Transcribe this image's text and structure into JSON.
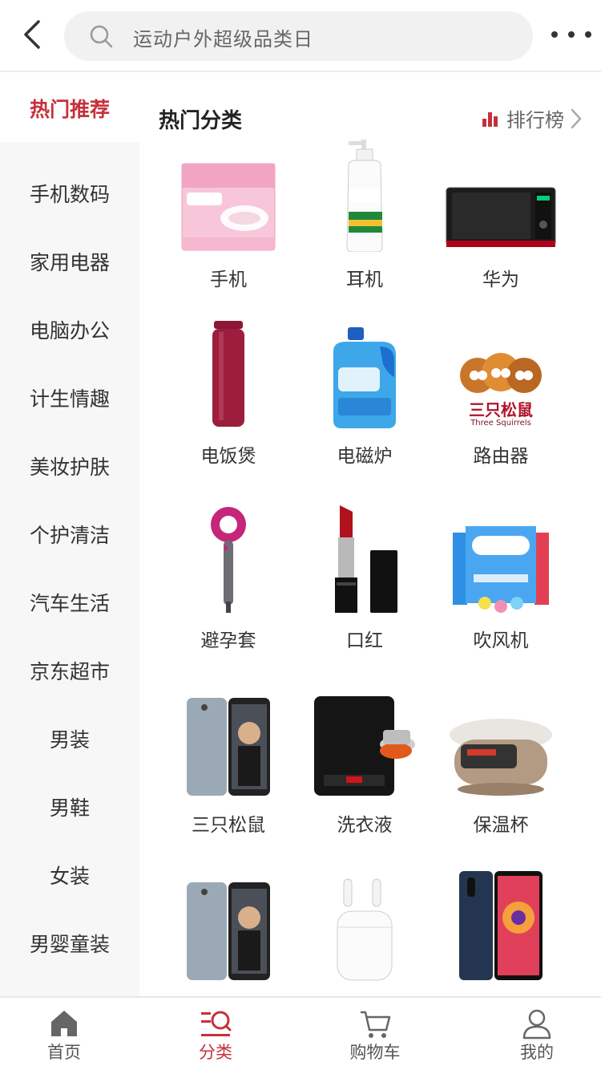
{
  "header": {
    "search_placeholder": "运动户外超级品类日"
  },
  "sidebar": {
    "items": [
      {
        "label": "热门推荐",
        "active": true
      },
      {
        "label": "手机数码"
      },
      {
        "label": "家用电器"
      },
      {
        "label": "电脑办公"
      },
      {
        "label": "计生情趣"
      },
      {
        "label": "美妆护肤"
      },
      {
        "label": "个护清洁"
      },
      {
        "label": "汽车生活"
      },
      {
        "label": "京东超市"
      },
      {
        "label": "男装"
      },
      {
        "label": "男鞋"
      },
      {
        "label": "女装"
      },
      {
        "label": "男婴童装"
      }
    ]
  },
  "main": {
    "section_title": "热门分类",
    "rank_label": "排行榜",
    "products": [
      {
        "label": "手机",
        "icon": "pads-pack-icon"
      },
      {
        "label": "耳机",
        "icon": "shampoo-bottle-icon"
      },
      {
        "label": "华为",
        "icon": "microwave-icon"
      },
      {
        "label": "电饭煲",
        "icon": "thermos-icon"
      },
      {
        "label": "电磁炉",
        "icon": "detergent-bottle-icon"
      },
      {
        "label": "路由器",
        "icon": "three-squirrels-logo-icon"
      },
      {
        "label": "避孕套",
        "icon": "hair-dryer-icon"
      },
      {
        "label": "口红",
        "icon": "lipstick-icon"
      },
      {
        "label": "吹风机",
        "icon": "condom-boxes-icon"
      },
      {
        "label": "三只松鼠",
        "icon": "smartphone-icon"
      },
      {
        "label": "洗衣液",
        "icon": "induction-cooker-icon"
      },
      {
        "label": "保温杯",
        "icon": "rice-cooker-icon"
      },
      {
        "label": "",
        "icon": "smartphone-icon"
      },
      {
        "label": "",
        "icon": "earbuds-case-icon"
      },
      {
        "label": "",
        "icon": "huawei-phone-icon"
      }
    ]
  },
  "three_squirrels_logo_text": "三只松鼠",
  "three_squirrels_logo_sub": "Three Squirrels",
  "tabbar": {
    "items": [
      {
        "label": "首页"
      },
      {
        "label": "分类",
        "active": true
      },
      {
        "label": "购物车"
      },
      {
        "label": "我的"
      }
    ]
  },
  "colors": {
    "accent": "#c5313b",
    "sidebar_bg": "#f7f7f7",
    "search_bg": "#f1f1f1"
  }
}
